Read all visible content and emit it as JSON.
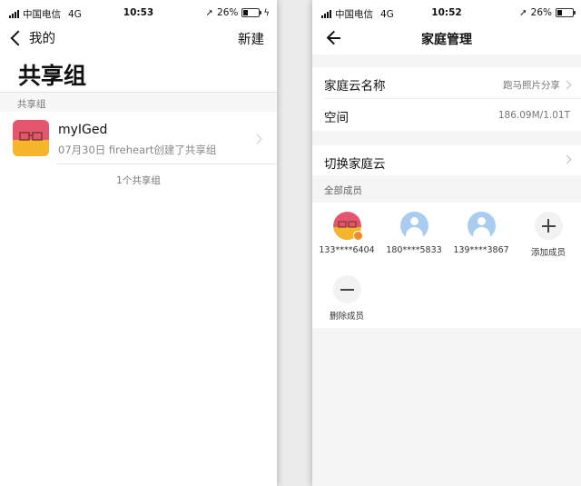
{
  "left": {
    "status": {
      "carrier": "中国电信",
      "network": "4G",
      "time": "10:53",
      "battery": "26%"
    },
    "nav": {
      "back_label": "我的",
      "right_action": "新建"
    },
    "title": "共享组",
    "section_label": "共享组",
    "group": {
      "name": "myIGed",
      "subtitle": "07月30日 fireheart创建了共享组"
    },
    "count_text": "1个共享组"
  },
  "right": {
    "status": {
      "carrier": "中国电信",
      "network": "4G",
      "time": "10:52",
      "battery": "26%"
    },
    "nav": {
      "title": "家庭管理"
    },
    "rows": [
      {
        "label": "家庭云名称",
        "value": "跑马照片分享"
      },
      {
        "label": "空间",
        "value": "186.09M/1.01T"
      }
    ],
    "switch_label": "切换家庭云",
    "members_section": "全部成员",
    "members": [
      {
        "label": "133****6404",
        "avatar": "group-image"
      },
      {
        "label": "180****5833",
        "avatar": "person-icon"
      },
      {
        "label": "139****3867",
        "avatar": "person-icon"
      },
      {
        "label": "添加成员",
        "avatar": "plus-icon"
      },
      {
        "label": "删除成员",
        "avatar": "minus-icon"
      }
    ]
  },
  "colors": {
    "battery_level": 0.26,
    "avatar_blue": "#a8cdf0",
    "group_pink": "#e4566e",
    "group_yellow": "#f5b62c"
  }
}
